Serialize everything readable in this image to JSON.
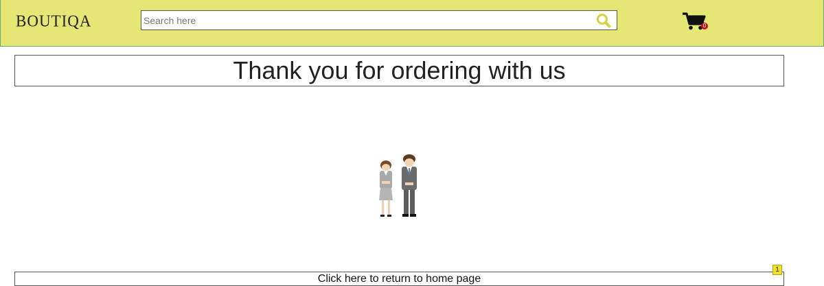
{
  "header": {
    "logo": "BOUTIQA",
    "search": {
      "placeholder": "Search here",
      "value": ""
    },
    "cart": {
      "count": "0"
    },
    "colors": {
      "background": "#e5e673",
      "search_icon": "#d6d23e",
      "cart_badge": "#c0141c"
    },
    "icons": {
      "search": "search-icon",
      "cart": "cart-icon"
    }
  },
  "main": {
    "title": "Thank you for ordering with us",
    "illustration": "bowing-couple-illustration",
    "return_link": "Click here to return to home page",
    "corner_badge": "1"
  }
}
